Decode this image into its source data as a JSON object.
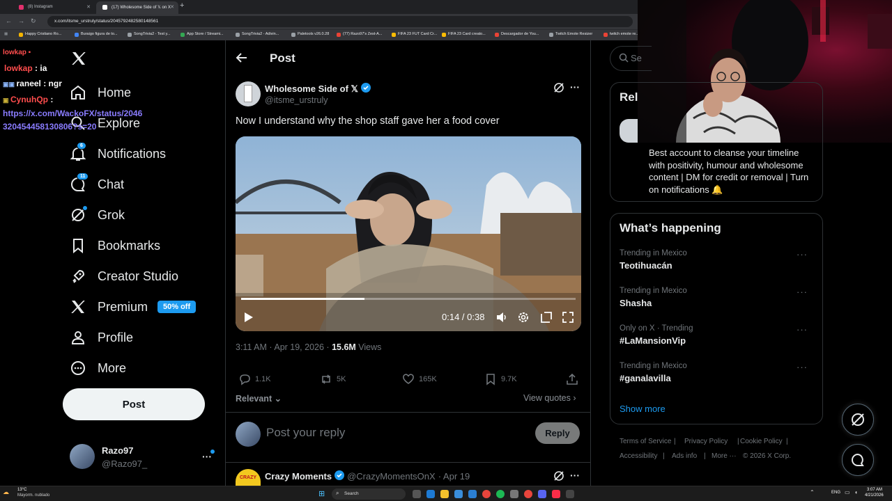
{
  "browser": {
    "tabs": [
      {
        "title": "(8) Instagram",
        "favicon_color": "#e1306c",
        "active": false
      },
      {
        "title": "(17) Wholesome Side of 𝕏 on X",
        "favicon_color": "#ffffff",
        "active": true
      }
    ],
    "new_tab_glyph": "+",
    "url": "x.com/itsme_urstruly/status/2045792482580148561",
    "bookmarks": [
      {
        "label": "Happy Cristiano Ro...",
        "color": "#f4b400"
      },
      {
        "label": "Buraigo figura de to...",
        "color": "#4285f4"
      },
      {
        "label": "SongTrivia2 - Test y...",
        "color": "#9aa0a6"
      },
      {
        "label": "App Store / Streami...",
        "color": "#34a853"
      },
      {
        "label": "SongTrivia2 - Adivin...",
        "color": "#9aa0a6"
      },
      {
        "label": "Paletools v26.0.28",
        "color": "#9aa0a6"
      },
      {
        "label": "(77) Razo97's Zest-A...",
        "color": "#ea4335"
      },
      {
        "label": "FIFA 23 FUT Card Cr...",
        "color": "#fbbc04"
      },
      {
        "label": "FIFA 23 Card creato...",
        "color": "#fbbc04"
      },
      {
        "label": "Descargador de You...",
        "color": "#ea4335"
      },
      {
        "label": "Twitch Emote Resizer",
        "color": "#9aa0a6"
      },
      {
        "label": "twitch emote re...",
        "color": "#ea4335"
      }
    ]
  },
  "chat_overlay": [
    {
      "user": "lowkap",
      "message": "ia",
      "color": "#ff4d4d"
    },
    {
      "user": "raneel",
      "message": "ngr",
      "color": "#ffffff"
    },
    {
      "user": "CynuhQp",
      "message": "",
      "color": "#ff4d4d"
    },
    {
      "user": "",
      "message": "https://x.com/WackoFX/status/2046320454458130806?s=20",
      "color": "#8a7cff"
    }
  ],
  "sidebar": {
    "items": [
      {
        "label": "Home",
        "icon": "home-icon"
      },
      {
        "label": "Explore",
        "icon": "search-icon"
      },
      {
        "label": "Notifications",
        "icon": "bell-icon",
        "badge": "6"
      },
      {
        "label": "Chat",
        "icon": "chat-icon",
        "badge": "11"
      },
      {
        "label": "Grok",
        "icon": "grok-icon"
      },
      {
        "label": "Bookmarks",
        "icon": "bookmark-icon"
      },
      {
        "label": "Creator Studio",
        "icon": "rocket-icon"
      },
      {
        "label": "Premium",
        "icon": "x-logo-icon",
        "pill": "50% off"
      },
      {
        "label": "Profile",
        "icon": "person-icon"
      },
      {
        "label": "More",
        "icon": "more-circle-icon"
      }
    ],
    "post_button": "Post",
    "account": {
      "name": "Razo97",
      "handle": "@Razo97_"
    }
  },
  "post": {
    "header_title": "Post",
    "author_name": "Wholesome Side of 𝕏",
    "author_handle": "@itsme_urstruly",
    "text": "Now I understand why the shop staff gave her a food cover",
    "video": {
      "time": "0:14 / 0:38",
      "progress": 0.368
    },
    "timestamp": "3:11 AM · Apr 19, 2026 ·",
    "views_count": "15.6M",
    "views_label": "Views",
    "stats": {
      "replies": "1.1K",
      "reposts": "5K",
      "likes": "165K",
      "bookmarks": "9.7K"
    },
    "sort_label": "Relevant",
    "view_quotes": "View quotes",
    "reply_placeholder": "Post your reply",
    "reply_button": "Reply",
    "next_post": {
      "name": "Crazy Moments",
      "handle": "@CrazyMomentsOnX",
      "date": "· Apr 19",
      "avatar_text": "CRAZY"
    }
  },
  "right": {
    "search_placeholder": "Se",
    "relevant_title": "Rel",
    "bio": "Best account to cleanse your timeline with positivity, humour and wholesome content | DM for credit or removal | Turn on notifications 🔔",
    "happening_title": "What’s happening",
    "trends": [
      {
        "context": "Trending in Mexico",
        "name": "Teotihuacán"
      },
      {
        "context": "Trending in Mexico",
        "name": "Shasha"
      },
      {
        "context": "Only on X · Trending",
        "name": "#LaMansionVip"
      },
      {
        "context": "Trending in Mexico",
        "name": "#ganalavilla"
      }
    ],
    "show_more": "Show more",
    "footer": [
      "Terms of Service",
      "|",
      "Privacy Policy",
      "|",
      "Cookie Policy",
      "|",
      "Accessibility",
      "|",
      "Ads info",
      "|",
      "More ···",
      "© 2026 X Corp."
    ]
  },
  "taskbar": {
    "weather_temp": "13°C",
    "weather_desc": "Mayorm. nublado",
    "search_label": "Search",
    "lang": "ENG",
    "time": "3:07 AM",
    "date": "4/21/2026"
  }
}
